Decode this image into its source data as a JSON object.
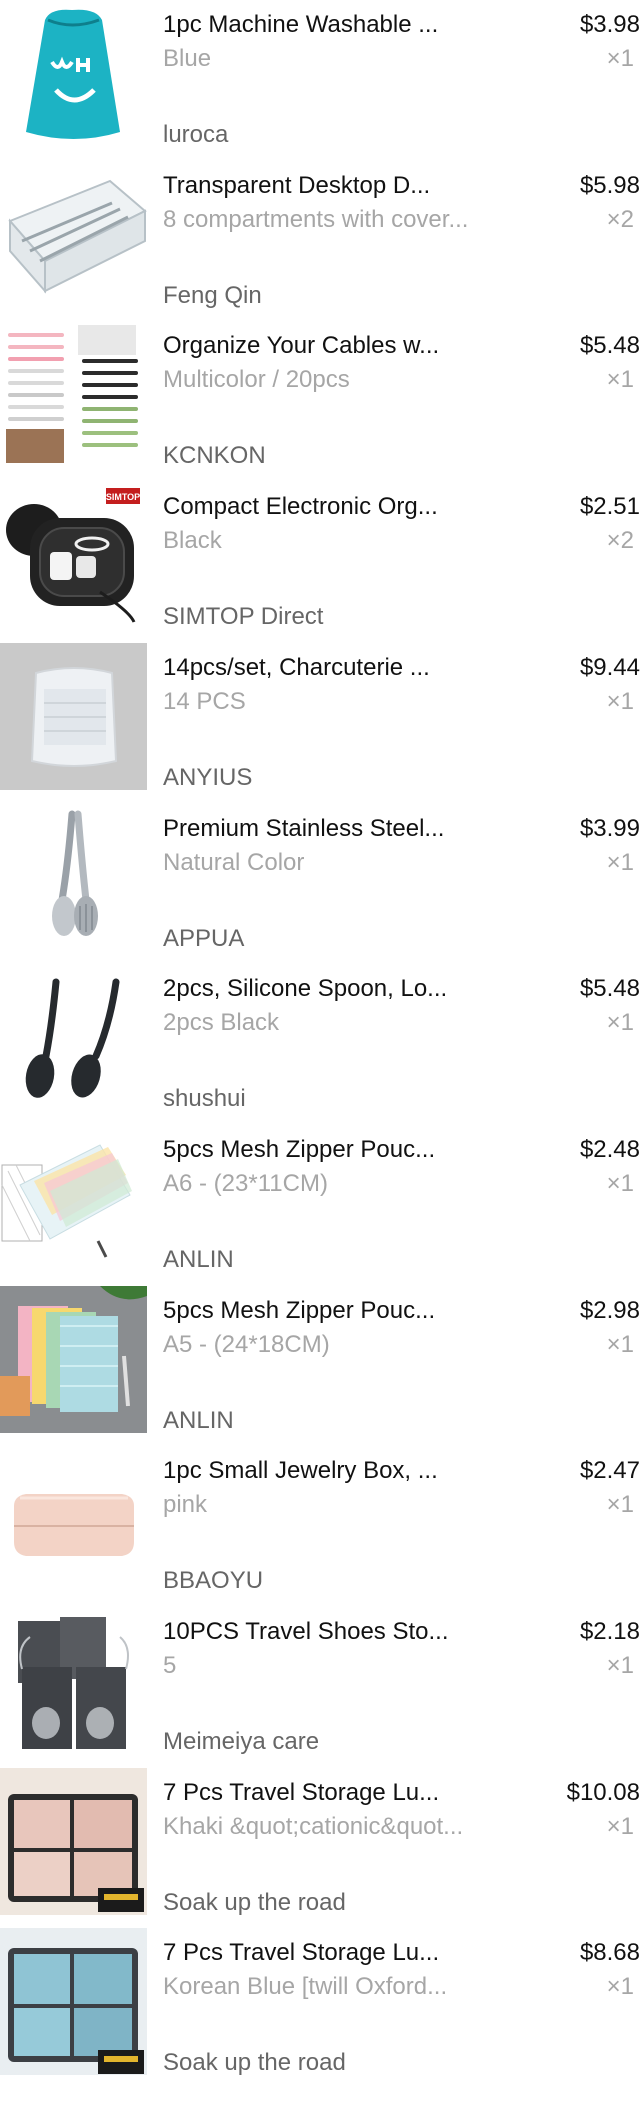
{
  "cart": {
    "items": [
      {
        "title": "1pc Machine Washable ...",
        "variant": "Blue",
        "price": "$3.98",
        "quantity": "×1",
        "store": "luroca",
        "image": "laundry-bag-image"
      },
      {
        "title": "Transparent Desktop D...",
        "variant": "8 compartments with cover...",
        "price": "$5.98",
        "quantity": "×2",
        "store": "Feng Qin",
        "image": "clear-organizer-box-image"
      },
      {
        "title": "Organize Your Cables w...",
        "variant": "Multicolor / 20pcs",
        "price": "$5.48",
        "quantity": "×1",
        "store": "KCNKON",
        "image": "cable-ties-image"
      },
      {
        "title": "Compact Electronic Org...",
        "variant": "Black",
        "price": "$2.51",
        "quantity": "×2",
        "store": "SIMTOP Direct",
        "image": "electronics-case-image",
        "image_badge": "SIMTOP"
      },
      {
        "title": "14pcs/set, Charcuterie ...",
        "variant": "14 PCS",
        "price": "$9.44",
        "quantity": "×1",
        "store": "ANYIUS",
        "image": "charcuterie-pack-image"
      },
      {
        "title": "Premium Stainless Steel...",
        "variant": "Natural Color",
        "price": "$3.99",
        "quantity": "×1",
        "store": "APPUA",
        "image": "steel-tongs-image"
      },
      {
        "title": "2pcs, Silicone Spoon, Lo...",
        "variant": "2pcs Black",
        "price": "$5.48",
        "quantity": "×1",
        "store": "shushui",
        "image": "silicone-spoons-image"
      },
      {
        "title": "5pcs Mesh Zipper Pouc...",
        "variant": "A6 - (23*11CM)",
        "price": "$2.48",
        "quantity": "×1",
        "store": "ANLIN",
        "image": "mesh-pouches-small-image"
      },
      {
        "title": "5pcs Mesh Zipper Pouc...",
        "variant": "A5 - (24*18CM)",
        "price": "$2.98",
        "quantity": "×1",
        "store": "ANLIN",
        "image": "mesh-pouches-large-image"
      },
      {
        "title": "1pc Small Jewelry Box, ...",
        "variant": "pink",
        "price": "$2.47",
        "quantity": "×1",
        "store": "BBAOYU",
        "image": "jewelry-box-image"
      },
      {
        "title": "10PCS Travel Shoes Sto...",
        "variant": "5",
        "price": "$2.18",
        "quantity": "×1",
        "store": "Meimeiya care",
        "image": "shoe-bags-image"
      },
      {
        "title": "7 Pcs Travel Storage Lu...",
        "variant": "Khaki &quot;cationic&quot...",
        "price": "$10.08",
        "quantity": "×1",
        "store": "Soak up the road",
        "image": "packing-cubes-khaki-image"
      },
      {
        "title": "7 Pcs Travel Storage Lu...",
        "variant": "Korean Blue [twill Oxford...",
        "price": "$8.68",
        "quantity": "×1",
        "store": "Soak up the road",
        "image": "packing-cubes-blue-image"
      }
    ]
  },
  "colors": {
    "title_text": "#111111",
    "variant_text": "#a6a6a6",
    "store_text": "#666666",
    "price_text": "#111111"
  }
}
